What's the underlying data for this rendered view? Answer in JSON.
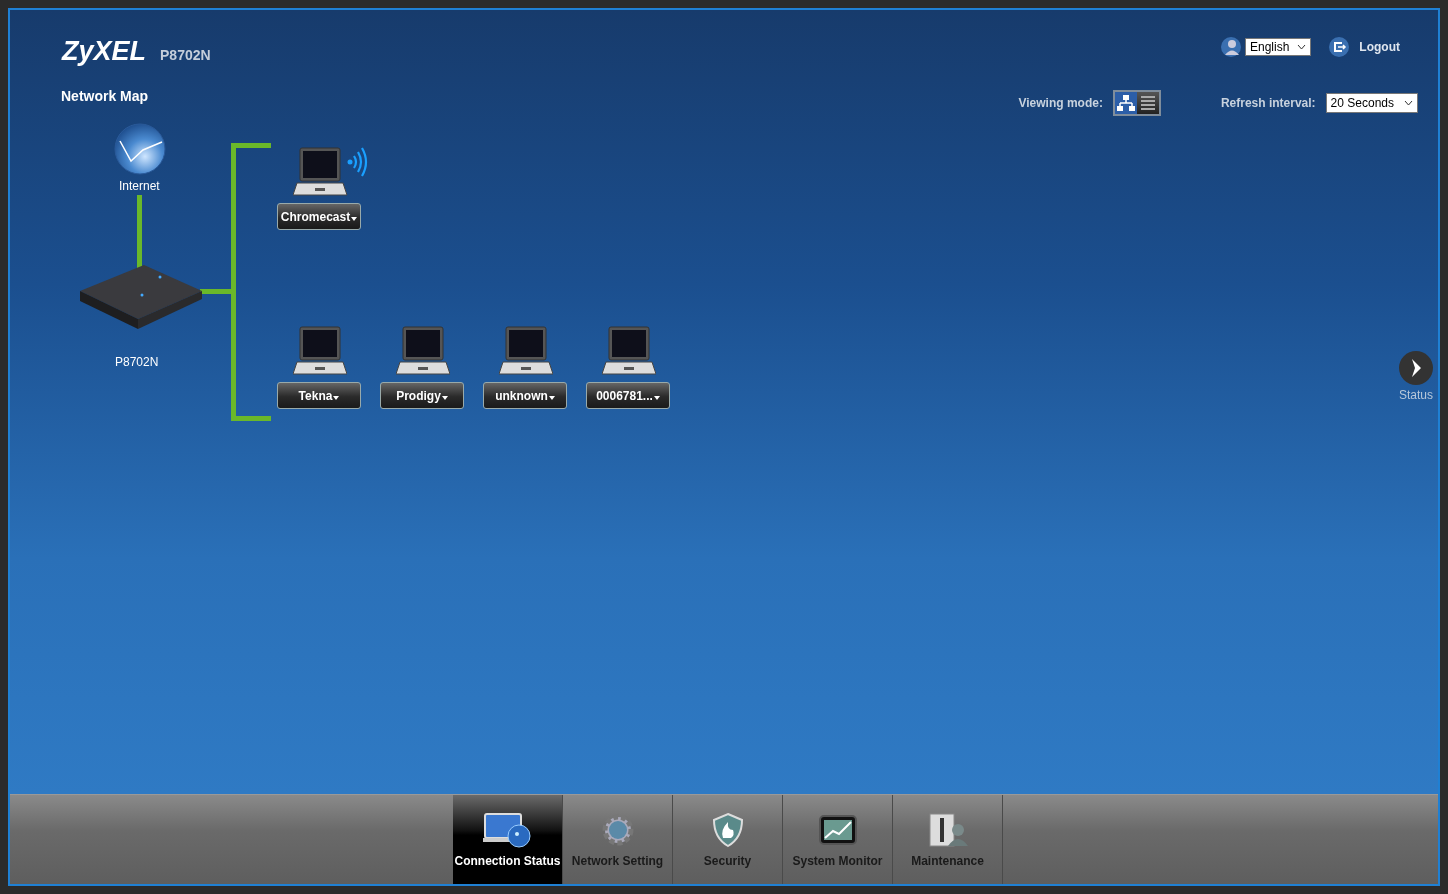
{
  "header": {
    "logo": "ZyXEL",
    "model": "P8702N",
    "language": "English",
    "logout": "Logout"
  },
  "page_title": "Network Map",
  "viewing_mode": {
    "label": "Viewing mode:",
    "modes": [
      {
        "kind": "map",
        "selected": true
      },
      {
        "kind": "list",
        "selected": false
      }
    ]
  },
  "refresh": {
    "label": "Refresh interval:",
    "value": "20 Seconds"
  },
  "map": {
    "internet": "Internet",
    "router": "P8702N",
    "wireless_devices": [
      {
        "name": "Chromecast"
      }
    ],
    "wired_devices": [
      {
        "name": "Tekna"
      },
      {
        "name": "Prodigy"
      },
      {
        "name": "unknown"
      },
      {
        "name": "0006781..."
      }
    ]
  },
  "status_button": "Status",
  "nav": [
    {
      "kind": "connection",
      "label": "Connection Status",
      "selected": true
    },
    {
      "kind": "network",
      "label": "Network Setting",
      "selected": false
    },
    {
      "kind": "security",
      "label": "Security",
      "selected": false
    },
    {
      "kind": "monitor",
      "label": "System Monitor",
      "selected": false
    },
    {
      "kind": "maintenance",
      "label": "Maintenance",
      "selected": false
    }
  ]
}
